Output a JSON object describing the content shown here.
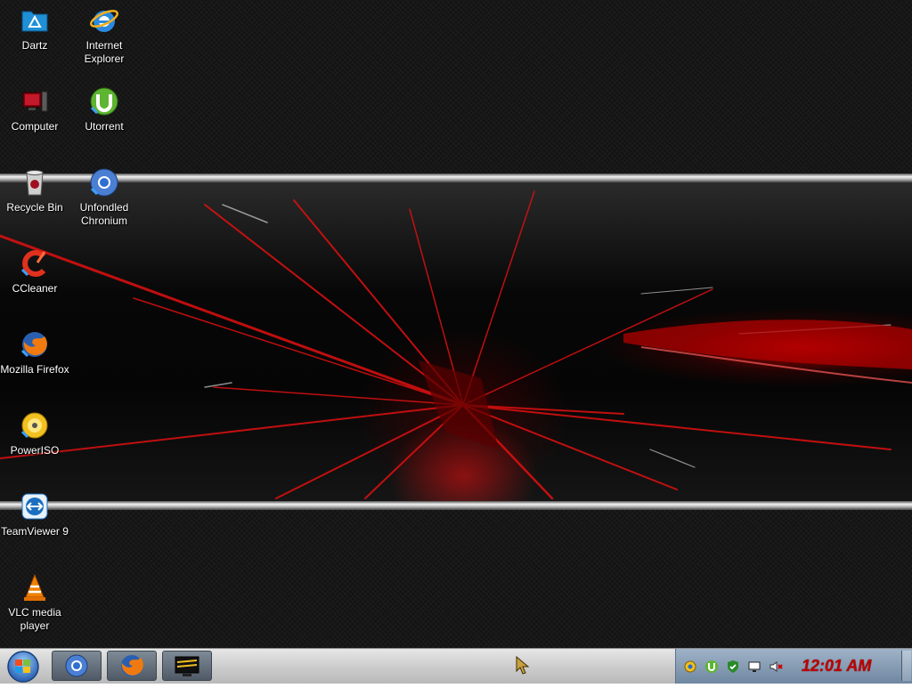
{
  "desktop": {
    "icons": [
      {
        "label": "Dartz",
        "icon": "dartz-folder-icon"
      },
      {
        "label": "Internet Explorer",
        "icon": "internet-explorer-icon"
      },
      {
        "label": "Computer",
        "icon": "computer-icon"
      },
      {
        "label": "Utorrent",
        "icon": "utorrent-icon"
      },
      {
        "label": "Recycle Bin",
        "icon": "recycle-bin-icon"
      },
      {
        "label": "Unfondled Chronium",
        "icon": "chromium-icon"
      },
      {
        "label": "CCleaner",
        "icon": "ccleaner-icon"
      },
      {
        "label": "Mozilla Firefox",
        "icon": "firefox-icon"
      },
      {
        "label": "PowerISO",
        "icon": "poweriso-icon"
      },
      {
        "label": "TeamViewer 9",
        "icon": "teamviewer-icon"
      },
      {
        "label": "VLC media player",
        "icon": "vlc-icon"
      }
    ]
  },
  "taskbar": {
    "start_icon": "windows-start-icon",
    "pinned": [
      {
        "icon": "chromium-icon"
      },
      {
        "icon": "firefox-icon"
      },
      {
        "icon": "task-app-icon"
      }
    ],
    "tray_icons": [
      "network-icon",
      "utorrent-icon",
      "shield-check-icon",
      "monitor-icon",
      "volume-muted-icon"
    ],
    "clock": "12:01 AM"
  },
  "colors": {
    "accent_red": "#c00000",
    "taskbar": "#d0d0d0",
    "tray": "#8aa0b8"
  }
}
